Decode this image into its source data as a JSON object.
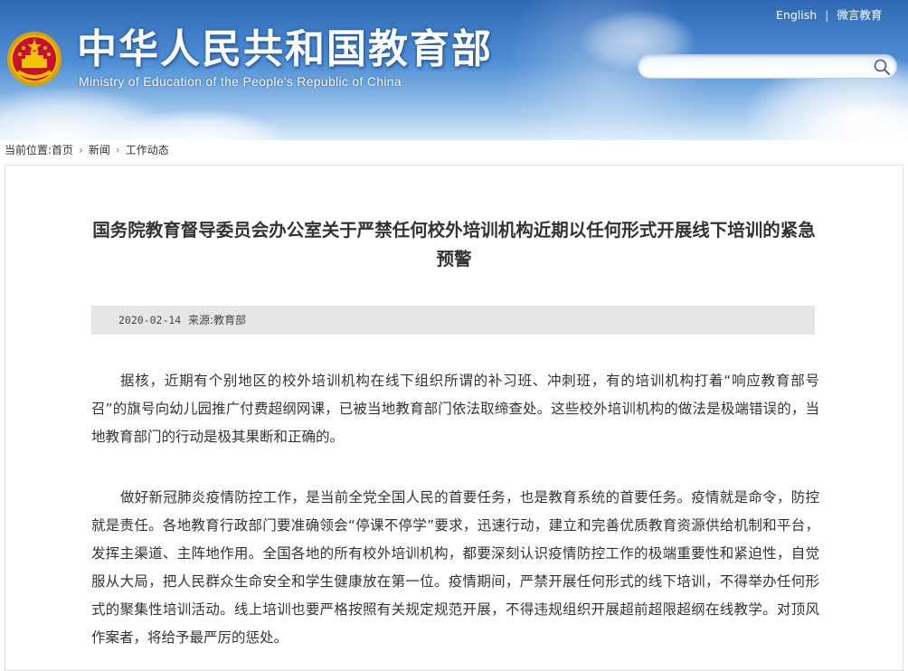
{
  "header": {
    "title": "中华人民共和国教育部",
    "subtitle": "Ministry of Education of the People's Republic of China",
    "links": {
      "english": "English",
      "separator": "|",
      "wechat": "微言教育"
    },
    "search": {
      "value": "",
      "placeholder": ""
    },
    "colors": {
      "sky_top": "#2f69b6",
      "sky_bottom": "#d9ebf9"
    }
  },
  "breadcrumb": {
    "prefix": "当前位置:",
    "items": [
      "首页",
      "新闻",
      "工作动态"
    ]
  },
  "article": {
    "title": "国务院教育督导委员会办公室关于严禁任何校外培训机构近期以任何形式开展线下培训的紧急预警",
    "date": "2020-02-14",
    "source": "来源:教育部",
    "paragraphs": [
      "据核，近期有个别地区的校外培训机构在线下组织所谓的补习班、冲刺班，有的培训机构打着“响应教育部号召”的旗号向幼儿园推广付费超纲网课，已被当地教育部门依法取缔查处。这些校外培训机构的做法是极端错误的，当地教育部门的行动是极其果断和正确的。",
      "做好新冠肺炎疫情防控工作，是当前全党全国人民的首要任务，也是教育系统的首要任务。疫情就是命令，防控就是责任。各地教育行政部门要准确领会“停课不停学”要求，迅速行动，建立和完善优质教育资源供给机制和平台，发挥主渠道、主阵地作用。全国各地的所有校外培训机构，都要深刻认识疫情防控工作的极端重要性和紧迫性，自觉服从大局，把人民群众生命安全和学生健康放在第一位。疫情期间，严禁开展任何形式的线下培训，不得举办任何形式的聚集性培训活动。线上培训也要严格按照有关规定规范开展，不得违规组织开展超前超限超纲在线教学。对顶风作案者，将给予最严厉的惩处。"
    ]
  },
  "icons": {
    "emblem": "national-emblem-icon",
    "search": "search-icon",
    "breadcrumb_separator": "chevron-right-icon"
  }
}
